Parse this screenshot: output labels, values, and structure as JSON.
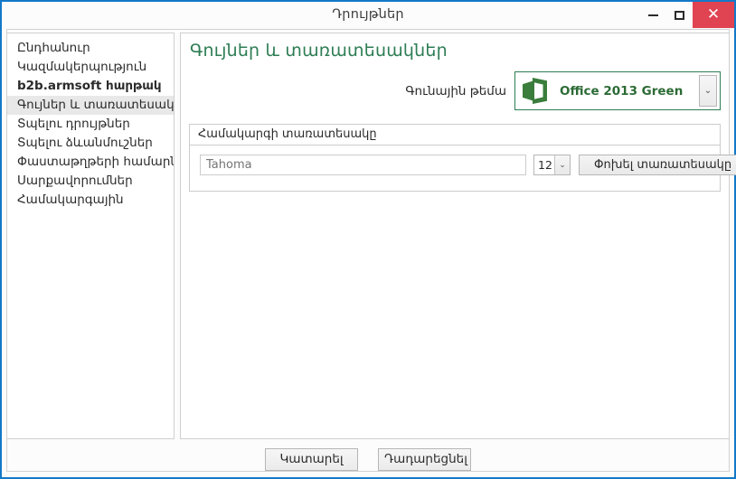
{
  "window": {
    "title": "Դրույթներ",
    "border_color": "#1479c8",
    "controls": {
      "minimize": "minimize-icon",
      "maximize": "maximize-icon",
      "close": "✕",
      "close_bg": "#e04351"
    }
  },
  "sidebar": {
    "items": [
      {
        "label": "Ընդհանուր",
        "bold": false,
        "selected": false
      },
      {
        "label": "Կազմակերպություն",
        "bold": false,
        "selected": false
      },
      {
        "label": "b2b.armsoft հարթակ",
        "bold": true,
        "selected": false
      },
      {
        "label": "Գույներ և տառատեսակներ",
        "bold": false,
        "selected": true
      },
      {
        "label": "Տպելու դրույթներ",
        "bold": false,
        "selected": false
      },
      {
        "label": "Տպելու ձևանմուշներ",
        "bold": false,
        "selected": false
      },
      {
        "label": "Փաստաթղթերի համարներ",
        "bold": false,
        "selected": false
      },
      {
        "label": "Սարքավորումներ",
        "bold": false,
        "selected": false
      },
      {
        "label": "Համակարգային",
        "bold": false,
        "selected": false
      }
    ]
  },
  "content": {
    "title": "Գույներ և տառատեսակներ",
    "title_color": "#2d7d54",
    "theme": {
      "label": "Գունային թեմա",
      "selected": "Office 2013 Green",
      "logo": "office-logo-icon",
      "accent_color": "#2d7d54",
      "arrow": "⌄"
    },
    "font_group": {
      "title": "Համակարգի տառատեսակը",
      "font_placeholder": "Tahoma",
      "font_value": "",
      "size_value": "12",
      "size_arrow": "⌄",
      "change_button": "Փոխել տառատեսակը"
    }
  },
  "footer": {
    "ok_label": "Կատարել",
    "cancel_label": "Դադարեցնել"
  }
}
